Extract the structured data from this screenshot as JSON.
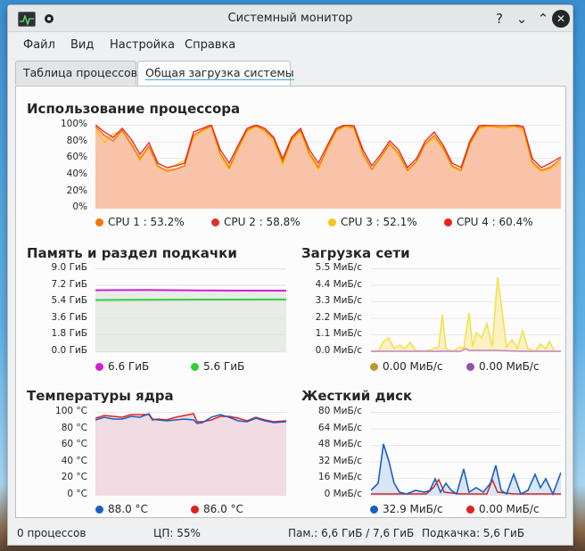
{
  "window": {
    "title": "Системный монитор",
    "help_label": "?",
    "minimize_label": "⌄",
    "maximize_label": "⌃",
    "close_label": "✕"
  },
  "menu": [
    "Файл",
    "Вид",
    "Настройка",
    "Справка"
  ],
  "tabs": [
    "Таблица процессов",
    "Общая загрузка системы"
  ],
  "cpu": {
    "title": "Использование процессора",
    "ticks": [
      "100%",
      "80%",
      "60%",
      "40%",
      "20%",
      "0%"
    ],
    "legend": [
      {
        "label": "CPU 1 : 53.2%",
        "color": "#f67400"
      },
      {
        "label": "CPU 2 : 58.8%",
        "color": "#e0302c"
      },
      {
        "label": "CPU 3 : 52.1%",
        "color": "#f5c518"
      },
      {
        "label": "CPU 4 : 60.4%",
        "color": "#e82020"
      }
    ],
    "fill_color": "#f9c0a8"
  },
  "memory": {
    "title": "Память и раздел подкачки",
    "ticks": [
      "9.0 ГиБ",
      "7.2 ГиБ",
      "5.4 ГиБ",
      "3.6 ГиБ",
      "1.8 ГиБ",
      "0.0 ГиБ"
    ],
    "legend": [
      {
        "label": "6.6 ГиБ",
        "color": "#d020d0"
      },
      {
        "label": "5.6 ГиБ",
        "color": "#30d030"
      }
    ]
  },
  "network": {
    "title": "Загрузка сети",
    "ticks": [
      "5.5 МиБ/с",
      "4.4 МиБ/с",
      "3.3 МиБ/с",
      "2.2 МиБ/с",
      "1.1 МиБ/с",
      "0.0 МиБ/с"
    ],
    "legend": [
      {
        "label": "0.00 МиБ/с",
        "color": "#b89a30"
      },
      {
        "label": "0.00 МиБ/с",
        "color": "#9050b0"
      }
    ]
  },
  "temperature": {
    "title": "Температуры ядра",
    "ticks": [
      "100 °C",
      "80 °C",
      "60 °C",
      "40 °C",
      "20 °C",
      "0 °C"
    ],
    "legend": [
      {
        "label": "88.0 °C",
        "color": "#1a60c0"
      },
      {
        "label": "86.0 °C",
        "color": "#e02020"
      }
    ]
  },
  "disk": {
    "title": "Жесткий диск",
    "ticks": [
      "80 МиБ/с",
      "64 МиБ/с",
      "48 МиБ/с",
      "32 МиБ/с",
      "16 МиБ/с",
      "0 МиБ/с"
    ],
    "legend": [
      {
        "label": "32.9 МиБ/с",
        "color": "#1a60c0"
      },
      {
        "label": "0.00 МиБ/с",
        "color": "#e02020"
      }
    ]
  },
  "status": {
    "processes": "0 процессов",
    "cpu": "ЦП: 55%",
    "memory": "Пам.: 6,6 ГиБ / 7,6 ГиБ",
    "swap": "Подкачка: 5,6 ГиБ"
  }
}
